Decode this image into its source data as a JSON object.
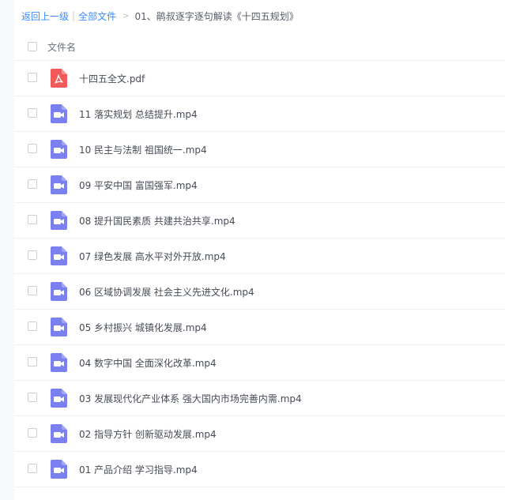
{
  "breadcrumb": {
    "back": "返回上一级",
    "separator": "|",
    "all_files": "全部文件",
    "arrow": ">",
    "current": "01、鹃叔逐字逐句解读《十四五规划》"
  },
  "header": {
    "column_name": "文件名"
  },
  "colors": {
    "link": "#3b8cff",
    "pdf_icon": "#f25a5a",
    "video_icon": "#7b80f0"
  },
  "files": [
    {
      "name": "十四五全文.pdf",
      "icon": "pdf-icon"
    },
    {
      "name": "11 落实规划 总结提升.mp4",
      "icon": "video-icon"
    },
    {
      "name": "10 民主与法制 祖国统一.mp4",
      "icon": "video-icon"
    },
    {
      "name": "09 平安中国 富国强军.mp4",
      "icon": "video-icon"
    },
    {
      "name": "08 提升国民素质 共建共治共享.mp4",
      "icon": "video-icon"
    },
    {
      "name": "07 绿色发展 高水平对外开放.mp4",
      "icon": "video-icon"
    },
    {
      "name": "06 区域协调发展 社会主义先进文化.mp4",
      "icon": "video-icon"
    },
    {
      "name": "05 乡村振兴 城镇化发展.mp4",
      "icon": "video-icon"
    },
    {
      "name": "04 数字中国 全面深化改革.mp4",
      "icon": "video-icon"
    },
    {
      "name": "03 发展现代化产业体系 强大国内市场完善内需.mp4",
      "icon": "video-icon"
    },
    {
      "name": "02 指导方针 创新驱动发展.mp4",
      "icon": "video-icon"
    },
    {
      "name": "01 产品介绍 学习指导.mp4",
      "icon": "video-icon"
    }
  ]
}
